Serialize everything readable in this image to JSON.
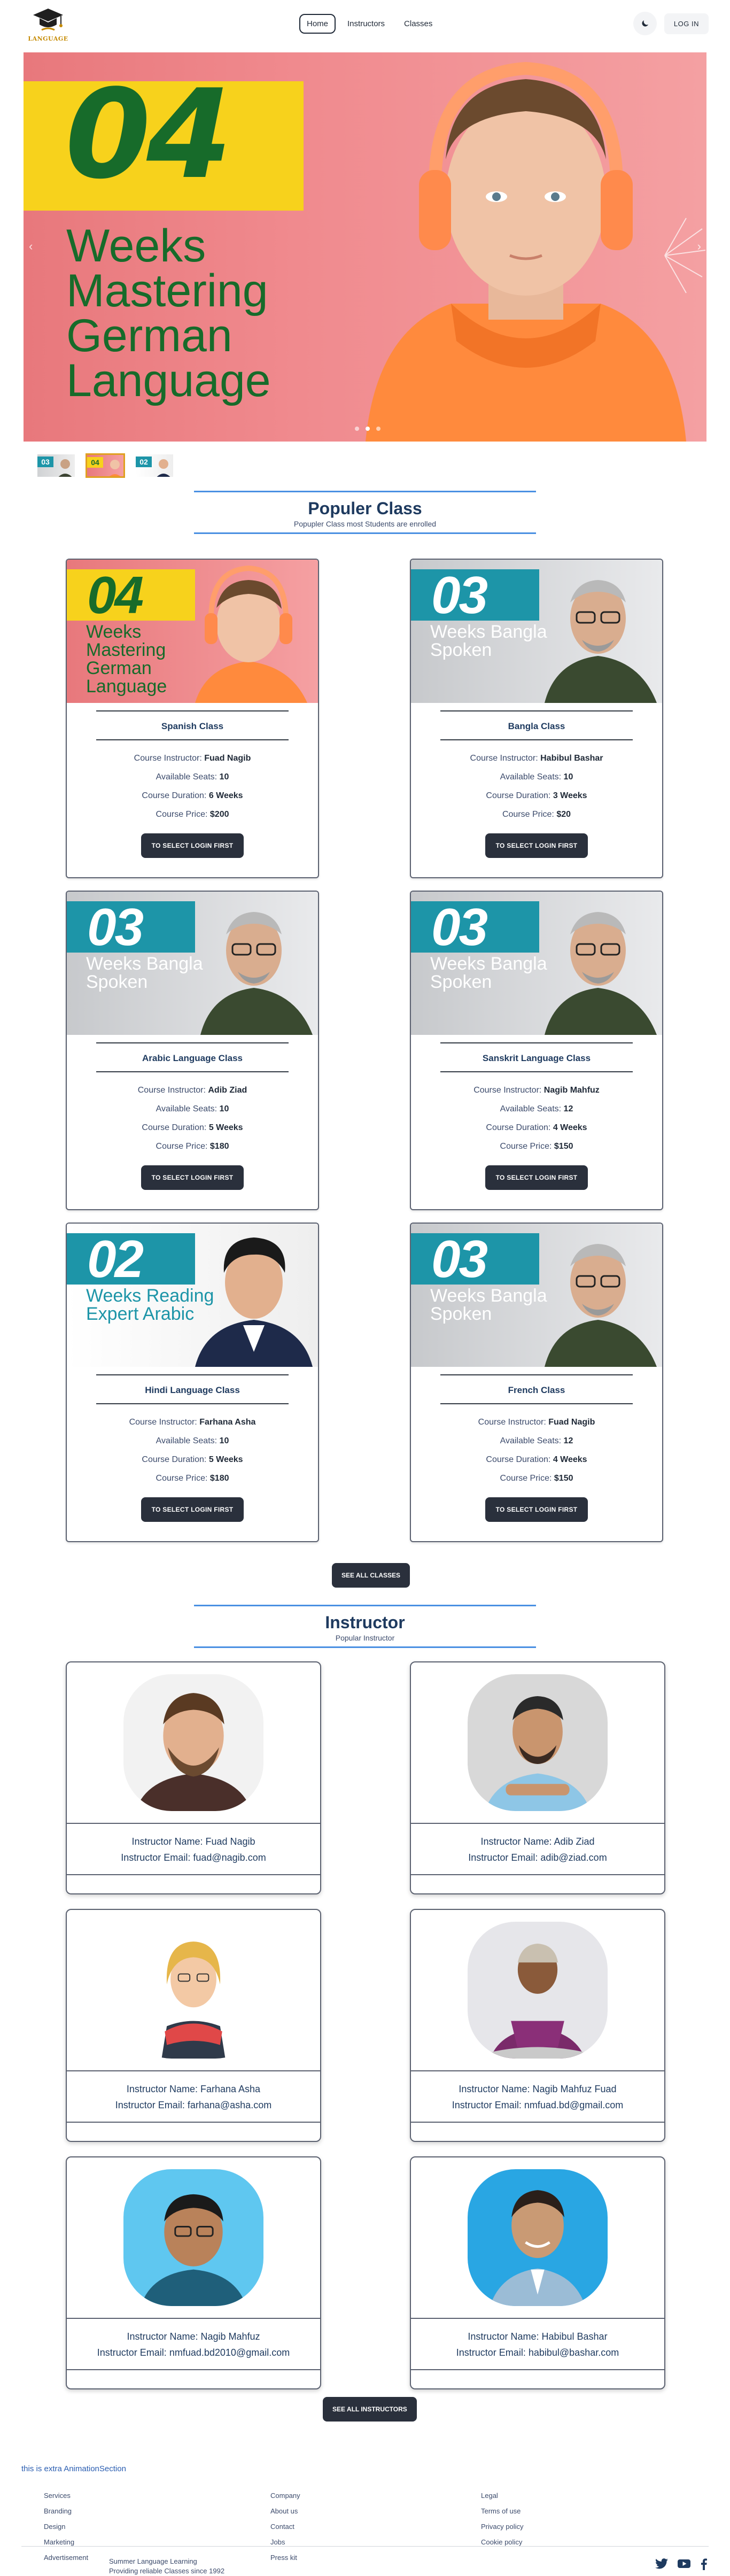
{
  "nav": {
    "logo_text": "LANGUAGE",
    "links": [
      "Home",
      "Instructors",
      "Classes"
    ],
    "login_label": "LOG IN",
    "theme_icon": "moon-icon"
  },
  "hero": {
    "number": "04",
    "title": "Weeks Mastering German Language",
    "thumb_numbers": [
      "03",
      "04",
      "02"
    ],
    "active_slide": 1,
    "slide_count": 3
  },
  "popular": {
    "title": "Populer Class",
    "subtitle": "Popupler Class most Students are enrolled",
    "labels": {
      "instructor": "Course Instructor:",
      "seats": "Available Seats:",
      "duration": "Course Duration:",
      "price": "Course Price:"
    },
    "classes": [
      {
        "badge": "04",
        "caption": "Weeks Mastering German Language",
        "name": "Spanish Class",
        "instructor": "Fuad Nagib",
        "seats": "10",
        "duration": "6 Weeks",
        "price": "$200",
        "button": "TO SELECT LOGIN FIRST"
      },
      {
        "badge": "03",
        "caption": "Weeks Bangla Spoken",
        "name": "Bangla Class",
        "instructor": "Habibul Bashar",
        "seats": "10",
        "duration": "3 Weeks",
        "price": "$20",
        "button": "TO SELECT LOGIN FIRST"
      },
      {
        "badge": "03",
        "caption": "Weeks Bangla Spoken",
        "name": "Arabic Language Class",
        "instructor": "Adib Ziad",
        "seats": "10",
        "duration": "5 Weeks",
        "price": "$180",
        "button": "TO SELECT LOGIN FIRST"
      },
      {
        "badge": "03",
        "caption": "Weeks Bangla Spoken",
        "name": "Sanskrit Language Class",
        "instructor": "Nagib Mahfuz",
        "seats": "12",
        "duration": "4 Weeks",
        "price": "$150",
        "button": "TO SELECT LOGIN FIRST"
      },
      {
        "badge": "02",
        "caption": "Weeks Reading Expert Arabic",
        "name": "Hindi Language Class",
        "instructor": "Farhana Asha",
        "seats": "10",
        "duration": "5 Weeks",
        "price": "$180",
        "button": "TO SELECT LOGIN FIRST"
      },
      {
        "badge": "03",
        "caption": "Weeks Bangla Spoken",
        "name": "French Class",
        "instructor": "Fuad Nagib",
        "seats": "12",
        "duration": "4 Weeks",
        "price": "$150",
        "button": "TO SELECT LOGIN FIRST"
      }
    ],
    "all_button": "SEE ALL CLASSES"
  },
  "instructors": {
    "title": "Instructor",
    "subtitle": "Popular Instructor",
    "name_label": "Instructor Name:",
    "email_label": "Instructor Email:",
    "items": [
      {
        "name": "Fuad Nagib",
        "email": "fuad@nagib.com"
      },
      {
        "name": "Adib Ziad",
        "email": "adib@ziad.com"
      },
      {
        "name": "Farhana Asha",
        "email": "farhana@asha.com"
      },
      {
        "name": "Nagib Mahfuz Fuad",
        "email": "nmfuad.bd@gmail.com"
      },
      {
        "name": "Nagib Mahfuz",
        "email": "nmfuad.bd2010@gmail.com"
      },
      {
        "name": "Habibul Bashar",
        "email": "habibul@bashar.com"
      }
    ],
    "all_button": "SEE ALL INSTRUCTORS"
  },
  "extra_text": "this is extra AnimationSection",
  "footer": {
    "services": [
      "Services",
      "Branding",
      "Design",
      "Marketing",
      "Advertisement"
    ],
    "company": [
      "Company",
      "About us",
      "Contact",
      "Jobs",
      "Press kit"
    ],
    "legal": [
      "Legal",
      "Terms of use",
      "Privacy policy",
      "Cookie policy"
    ],
    "brand_name": "Summer Language Learning",
    "brand_tagline": "Providing reliable Classes since 1992",
    "social": [
      "twitter-icon",
      "youtube-icon",
      "facebook-icon"
    ]
  },
  "colors": {
    "brand_green": "#176b2a",
    "hero_yellow": "#f7d21c",
    "badge_teal": "#1d95a8",
    "accent_blue": "#4a90e2",
    "button_dark": "#2a303c"
  }
}
